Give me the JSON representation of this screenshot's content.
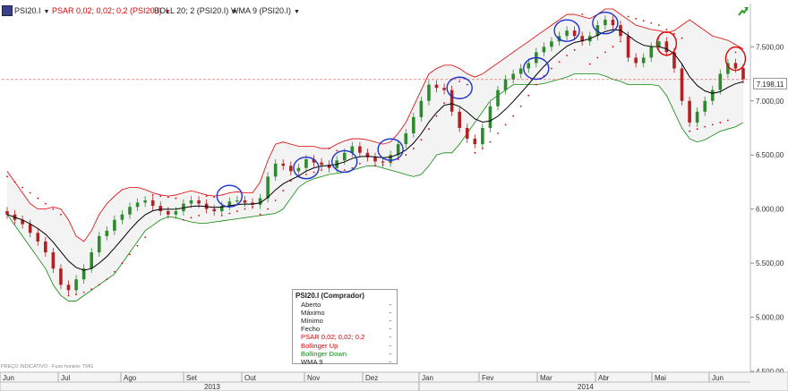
{
  "toolbar": {
    "symbol": "PSI20.I",
    "psar": "PSAR 0,02; 0,02; 0,2 (PSI20.I)",
    "boll": "BOLL 20; 2 (PSI20.I)",
    "wma": "WMA 9 (PSI20.I)"
  },
  "legend": {
    "title": "PSI20.I (Comprador)",
    "rows": [
      {
        "label": "Aberto",
        "value": "-"
      },
      {
        "label": "Máximo",
        "value": "-"
      },
      {
        "label": "Mínimo",
        "value": "-"
      },
      {
        "label": "Fecho",
        "value": "-"
      },
      {
        "label": "PSAR 0,02; 0,02; 0,2",
        "value": "-"
      },
      {
        "label": "Bollinger Up",
        "value": "-"
      },
      {
        "label": "Bollinger Down",
        "value": "-"
      },
      {
        "label": "WMA 9",
        "value": "-"
      }
    ]
  },
  "footer_note": "PREÇO INDICATIVO · Fuso horário: TMG",
  "colors": {
    "psar": "#e00000",
    "boll_up": "#e00000",
    "boll_down": "#0a8a0a",
    "wma": "#000000",
    "up_candle": "#2f8a2f",
    "down_candle": "#b22222",
    "highlight_blue": "#1f2fd0",
    "highlight_red": "#e00000"
  },
  "chart_data": {
    "type": "candlestick",
    "title": "",
    "ylim": [
      4500,
      7850
    ],
    "yticks": [
      "7.500,00",
      "7.000,00",
      "6.500,00",
      "6.000,00",
      "5.500,00",
      "5.000,00",
      "4.500,00"
    ],
    "ytick_values": [
      7500,
      7000,
      6500,
      6000,
      5500,
      5000,
      4500
    ],
    "months": [
      "Jun",
      "Jul",
      "Ago",
      "Set",
      "Out",
      "Nov",
      "Dez",
      "Jan",
      "Fev",
      "Mar",
      "Abr",
      "Mai",
      "Jun"
    ],
    "years": [
      "2013",
      "2014"
    ],
    "current_price_label": "7.198,11",
    "current_price": 7198.11,
    "close_series": [
      5950,
      5900,
      5860,
      5780,
      5700,
      5600,
      5450,
      5300,
      5250,
      5350,
      5450,
      5600,
      5750,
      5800,
      5900,
      5950,
      6020,
      6060,
      6080,
      6030,
      5980,
      5950,
      5980,
      6050,
      6080,
      6050,
      6000,
      5980,
      6030,
      6070,
      6080,
      6060,
      6040,
      6100,
      6300,
      6420,
      6400,
      6350,
      6380,
      6460,
      6430,
      6410,
      6380,
      6450,
      6520,
      6580,
      6520,
      6480,
      6440,
      6430,
      6500,
      6600,
      6700,
      6850,
      7000,
      7150,
      7120,
      7100,
      6900,
      6750,
      6650,
      6600,
      6750,
      6950,
      7100,
      7200,
      7250,
      7300,
      7350,
      7450,
      7500,
      7550,
      7600,
      7650,
      7600,
      7550,
      7600,
      7700,
      7750,
      7700,
      7600,
      7400,
      7350,
      7400,
      7500,
      7550,
      7450,
      7300,
      7000,
      6800,
      6900,
      7000,
      7100,
      7250,
      7350,
      7300,
      7200
    ],
    "psar_series": [
      6300,
      6250,
      6200,
      6150,
      6100,
      6050,
      6000,
      5950,
      5200,
      5210,
      5230,
      5260,
      5300,
      5350,
      5420,
      5500,
      5580,
      5660,
      5740,
      6130,
      6120,
      6110,
      6100,
      5900,
      5920,
      5940,
      6120,
      6110,
      5940,
      5960,
      5980,
      6000,
      6020,
      5950,
      6000,
      6080,
      6170,
      6260,
      6300,
      6320,
      6340,
      6360,
      6560,
      6540,
      6360,
      6380,
      6420,
      6480,
      6400,
      6410,
      6430,
      6460,
      6500,
      6560,
      6640,
      6740,
      6860,
      6980,
      7200,
      7180,
      7150,
      6520,
      6560,
      6620,
      6700,
      6780,
      6860,
      6950,
      7050,
      7150,
      7230,
      7300,
      7360,
      7420,
      7470,
      7800,
      7340,
      7400,
      7450,
      7500,
      7550,
      7780,
      7760,
      7740,
      7720,
      7700,
      7660,
      7620,
      7580,
      6720,
      6740,
      6760,
      6780,
      6800,
      6820,
      7450,
      7300
    ],
    "boll_up_series": [
      6350,
      6250,
      6150,
      6050,
      6000,
      6000,
      6020,
      6000,
      5900,
      5750,
      5700,
      5800,
      5950,
      6050,
      6120,
      6180,
      6200,
      6200,
      6180,
      6150,
      6130,
      6120,
      6130,
      6150,
      6170,
      6150,
      6130,
      6120,
      6130,
      6150,
      6160,
      6150,
      6150,
      6250,
      6450,
      6600,
      6620,
      6600,
      6580,
      6580,
      6580,
      6560,
      6560,
      6600,
      6630,
      6650,
      6650,
      6640,
      6620,
      6600,
      6620,
      6700,
      6800,
      6950,
      7100,
      7250,
      7300,
      7330,
      7330,
      7300,
      7250,
      7220,
      7250,
      7300,
      7350,
      7400,
      7450,
      7500,
      7550,
      7600,
      7650,
      7700,
      7750,
      7800,
      7800,
      7780,
      7760,
      7800,
      7850,
      7850,
      7800,
      7750,
      7700,
      7680,
      7660,
      7650,
      7630,
      7650,
      7700,
      7750,
      7700,
      7650,
      7600,
      7580,
      7560,
      7520,
      7480
    ],
    "boll_down_series": [
      5950,
      5850,
      5750,
      5650,
      5550,
      5450,
      5300,
      5200,
      5150,
      5150,
      5200,
      5250,
      5300,
      5350,
      5400,
      5500,
      5600,
      5700,
      5800,
      5850,
      5900,
      5930,
      5920,
      5900,
      5880,
      5870,
      5870,
      5880,
      5890,
      5900,
      5910,
      5920,
      5930,
      5940,
      5950,
      5960,
      6000,
      6100,
      6200,
      6250,
      6280,
      6300,
      6320,
      6330,
      6340,
      6360,
      6380,
      6400,
      6400,
      6380,
      6360,
      6340,
      6320,
      6300,
      6320,
      6400,
      6500,
      6520,
      6520,
      6600,
      6700,
      6800,
      6900,
      7000,
      7050,
      7100,
      7150,
      7150,
      7150,
      7150,
      7160,
      7180,
      7200,
      7220,
      7250,
      7250,
      7250,
      7250,
      7230,
      7200,
      7180,
      7150,
      7150,
      7150,
      7150,
      7140,
      7050,
      6900,
      6750,
      6650,
      6620,
      6640,
      6680,
      6720,
      6740,
      6760,
      6800
    ],
    "circles_blue": [
      [
        29,
        6120
      ],
      [
        39,
        6380
      ],
      [
        44,
        6440
      ],
      [
        50,
        6550
      ],
      [
        59,
        7120
      ],
      [
        69,
        7300
      ],
      [
        73,
        7650
      ],
      [
        78,
        7720
      ]
    ],
    "circles_red": [
      [
        86,
        7530
      ],
      [
        95,
        7390
      ]
    ]
  }
}
